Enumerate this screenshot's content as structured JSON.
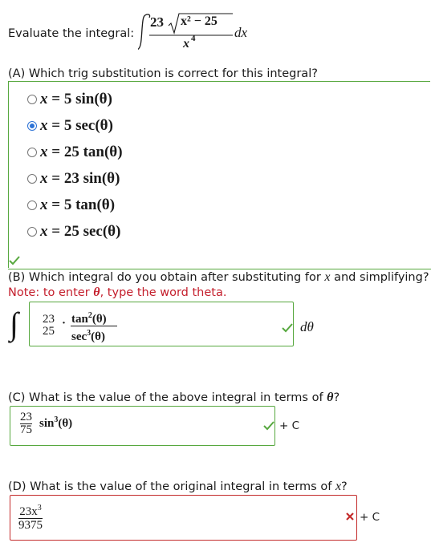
{
  "header": {
    "prompt": "Evaluate the integral:",
    "integral": {
      "coefficient": "23",
      "radicand": "x² − 25",
      "denominator": "x",
      "denominator_power": "4",
      "differential": "dx"
    }
  },
  "part_a": {
    "question": "(A) Which trig substitution is correct for this integral?",
    "options": [
      {
        "lhs": "x",
        "eq": "=",
        "rhs": "5 sin(θ)",
        "selected": false
      },
      {
        "lhs": "x",
        "eq": "=",
        "rhs": "5 sec(θ)",
        "selected": true
      },
      {
        "lhs": "x",
        "eq": "=",
        "rhs": "25 tan(θ)",
        "selected": false
      },
      {
        "lhs": "x",
        "eq": "=",
        "rhs": "23 sin(θ)",
        "selected": false
      },
      {
        "lhs": "x",
        "eq": "=",
        "rhs": "5 tan(θ)",
        "selected": false
      },
      {
        "lhs": "x",
        "eq": "=",
        "rhs": "25 sec(θ)",
        "selected": false
      }
    ],
    "status": "correct"
  },
  "part_b": {
    "question_prefix": "(B) Which integral do you obtain after substituting for",
    "question_var": "x",
    "question_suffix": "and simplifying?",
    "note_prefix": "Note: to enter",
    "note_symbol": "θ",
    "note_suffix": ", type the word theta.",
    "integral_sign": "∫",
    "answer": {
      "coef_num": "23",
      "coef_den": "25",
      "dot": "·",
      "num_fn": "tan",
      "num_pow": "2",
      "num_arg": "(θ)",
      "den_fn": "sec",
      "den_pow": "3",
      "den_arg": "(θ)"
    },
    "differential": "dθ",
    "status": "correct"
  },
  "part_c": {
    "question_prefix": "(C) What is the value of the above integral in terms of",
    "question_var": "θ",
    "question_suffix": "?",
    "answer": {
      "coef_num": "23",
      "coef_den": "75",
      "fn": "sin",
      "pow": "3",
      "arg": "(θ)"
    },
    "plus_c": "+ C",
    "status": "correct"
  },
  "part_d": {
    "question_prefix": "(D) What is the value of the original integral in terms of",
    "question_var": "x",
    "question_suffix": "?",
    "answer": {
      "num": "23x",
      "num_pow": "3",
      "den": "9375"
    },
    "plus_c": "+ C",
    "status": "incorrect"
  },
  "colors": {
    "correct": "#57a83f",
    "incorrect": "#c42b2b",
    "note": "#c41e2c",
    "radio_selected": "#2c72d6"
  }
}
